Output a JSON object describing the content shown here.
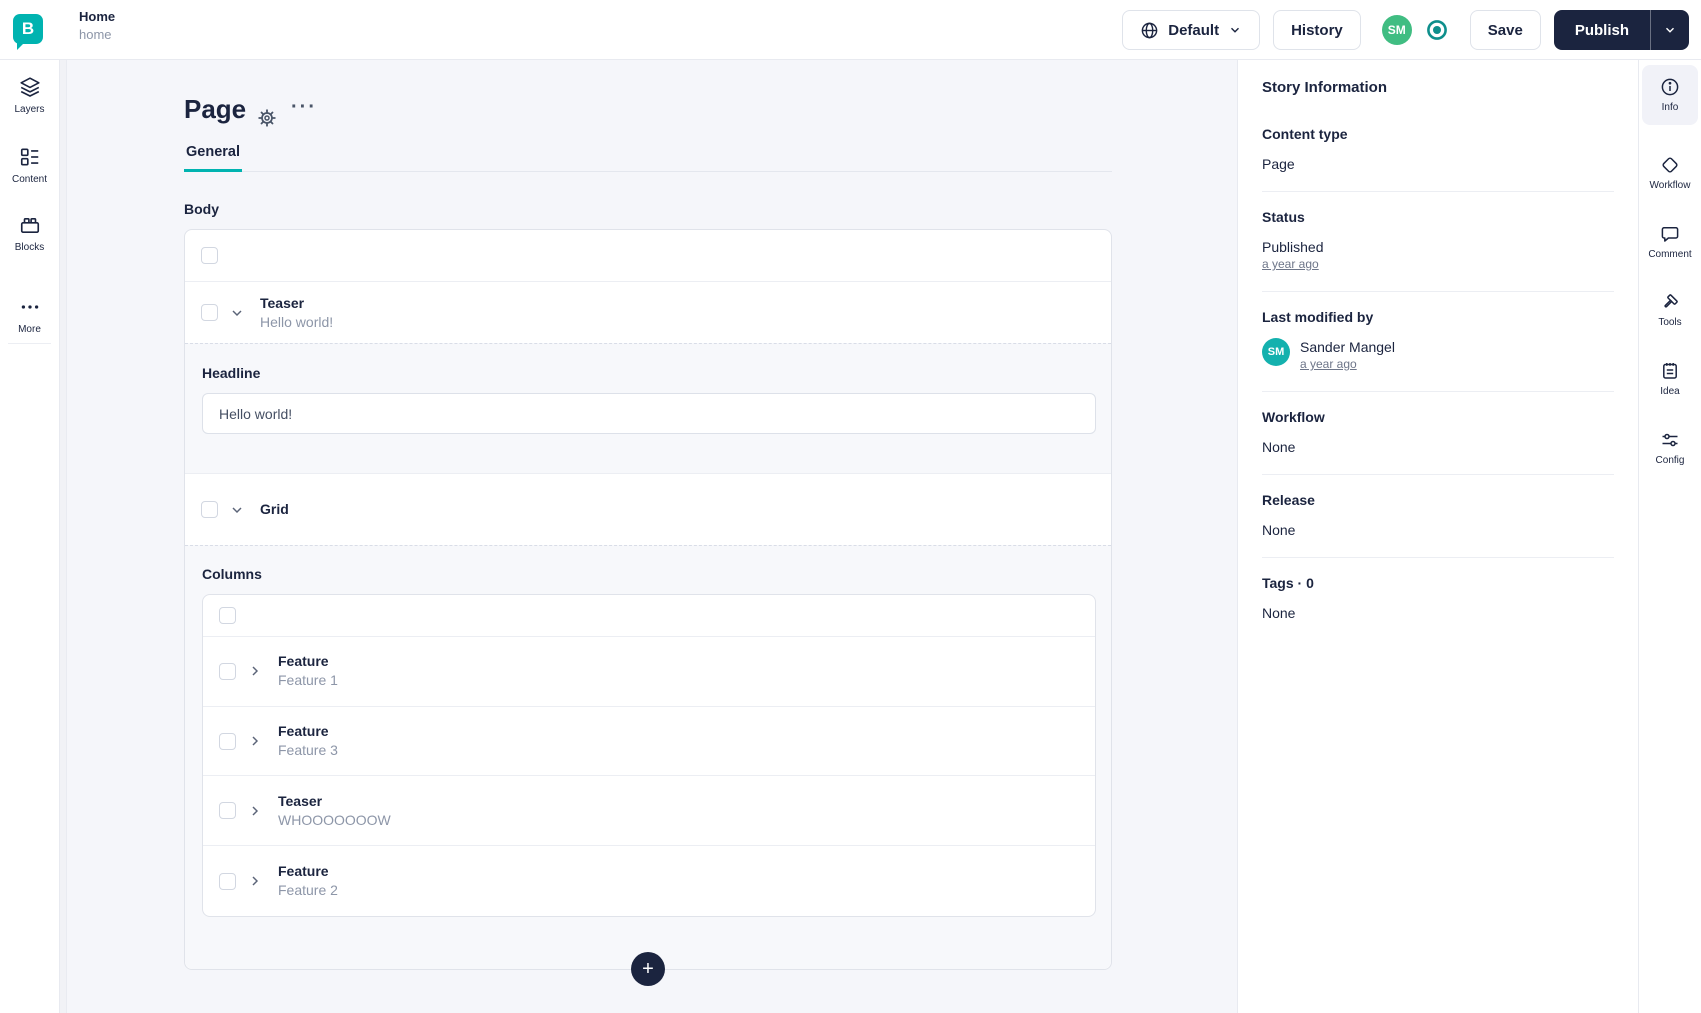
{
  "colors": {
    "accent_teal": "#00b3b0",
    "navy": "#1b243f",
    "avatar_green": "#40bd82",
    "avatar_teal": "#14b1ae",
    "main_bg": "#f5f6fa"
  },
  "header": {
    "logo_letter": "B",
    "breadcrumb": {
      "title": "Home",
      "subtitle": "home"
    },
    "language_label": "Default",
    "history_label": "History",
    "avatar_initials": "SM",
    "save_label": "Save",
    "publish_label": "Publish"
  },
  "left_nav": {
    "items": [
      {
        "label": "Layers"
      },
      {
        "label": "Content"
      },
      {
        "label": "Blocks"
      },
      {
        "label": "More"
      }
    ]
  },
  "editor": {
    "page_title": "Page",
    "tab_general": "General",
    "body_label": "Body",
    "teaser": {
      "type": "Teaser",
      "preview": "Hello world!"
    },
    "headline": {
      "label": "Headline",
      "value": "Hello world!"
    },
    "grid": {
      "type": "Grid"
    },
    "columns": {
      "label": "Columns",
      "items": [
        {
          "type": "Feature",
          "preview": "Feature 1"
        },
        {
          "type": "Feature",
          "preview": "Feature 3"
        },
        {
          "type": "Teaser",
          "preview": "WHOOOOOOOW"
        },
        {
          "type": "Feature",
          "preview": "Feature 2"
        }
      ]
    },
    "add_button": "+"
  },
  "story_info": {
    "title": "Story Information",
    "content_type_label": "Content type",
    "content_type_value": "Page",
    "status_label": "Status",
    "status_value": "Published",
    "status_time": "a year ago",
    "modified_label": "Last modified by",
    "modified_avatar": "SM",
    "modified_name": "Sander Mangel",
    "modified_time": "a year ago",
    "workflow_label": "Workflow",
    "workflow_value": "None",
    "release_label": "Release",
    "release_value": "None",
    "tags_label": "Tags · 0",
    "tags_value": "None"
  },
  "right_toolbar": {
    "items": [
      {
        "label": "Info"
      },
      {
        "label": "Workflow"
      },
      {
        "label": "Comment"
      },
      {
        "label": "Tools"
      },
      {
        "label": "Idea"
      },
      {
        "label": "Config"
      }
    ]
  }
}
